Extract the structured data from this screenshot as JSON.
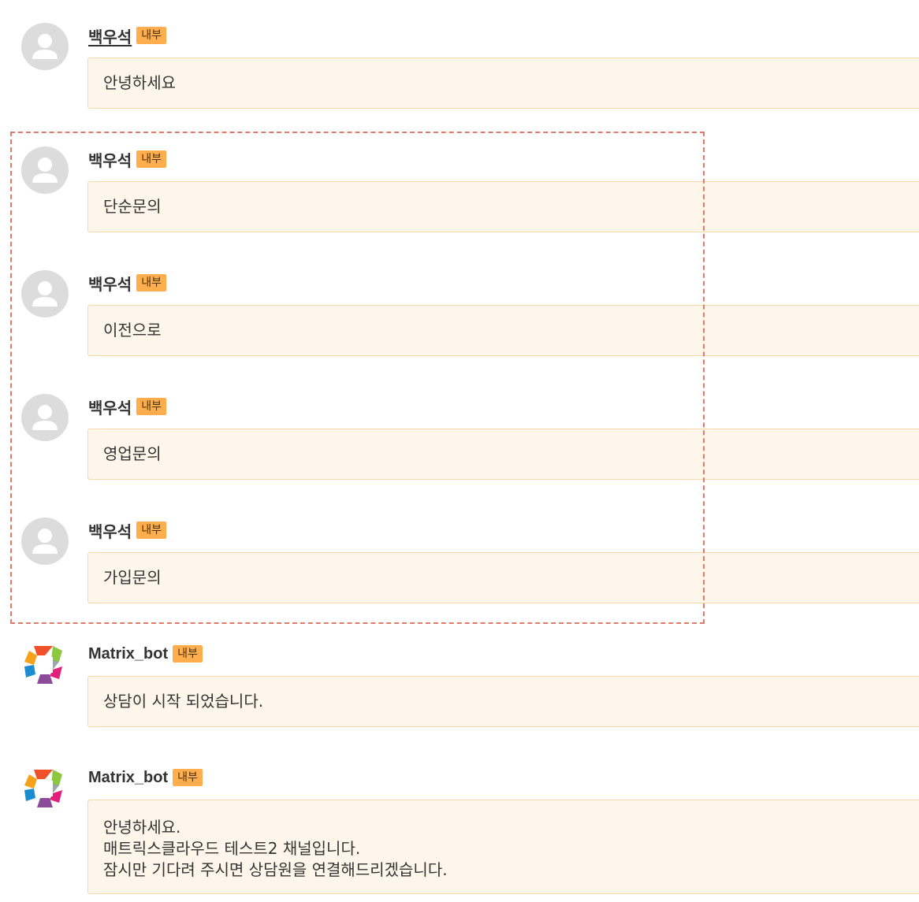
{
  "badge_label": "내부",
  "messages": [
    {
      "sender": "백우석",
      "text": "안녕하세요"
    },
    {
      "sender": "백우석",
      "text": "단순문의"
    },
    {
      "sender": "백우석",
      "text": "이전으로"
    },
    {
      "sender": "백우석",
      "text": "영업문의"
    },
    {
      "sender": "백우석",
      "text": "가입문의"
    },
    {
      "sender": "Matrix_bot",
      "text": "상담이 시작 되었습니다."
    },
    {
      "sender": "Matrix_bot",
      "text": "안녕하세요.\n매트릭스클라우드 테스트2 채널입니다.\n잠시만 기다려 주시면 상담원을 연결해드리겠습니다."
    }
  ],
  "colors": {
    "badge": "#ffad4d",
    "bubble_bg": "#fff6eb",
    "bubble_border": "#f5d9ad",
    "highlight_border": "#e07b6a",
    "avatar_placeholder": "#dcdcdc"
  },
  "icons": {
    "user_avatar": "user-silhouette-icon",
    "bot_avatar": "matrix-logo-icon"
  }
}
